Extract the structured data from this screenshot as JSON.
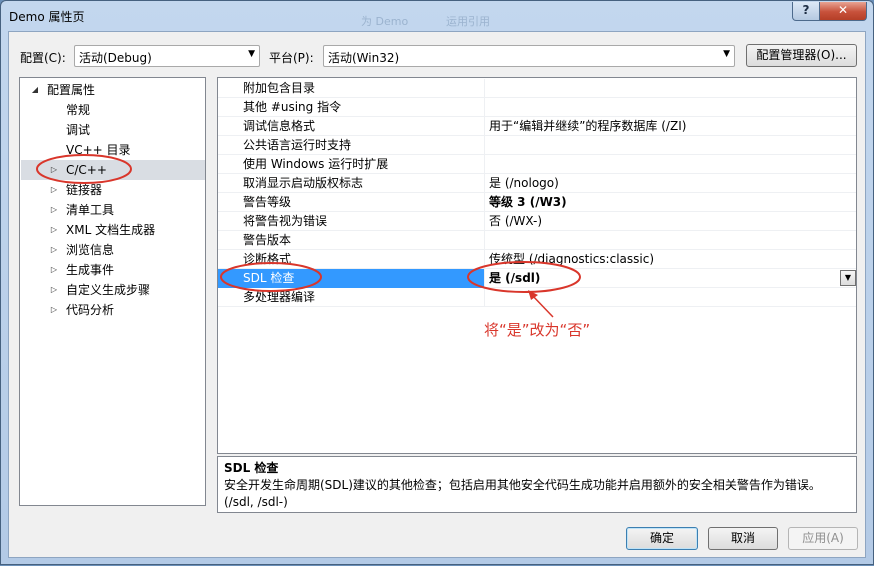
{
  "window": {
    "title": "Demo 属性页",
    "ghost_texts": [
      "为 Demo",
      "运用引用"
    ],
    "help_button": "?",
    "close_button": "✕"
  },
  "toolbar": {
    "config_label": "配置(C):",
    "config_value": "活动(Debug)",
    "platform_label": "平台(P):",
    "platform_value": "活动(Win32)",
    "config_manager_button": "配置管理器(O)..."
  },
  "tree": {
    "root": "配置属性",
    "items": [
      {
        "label": "常规",
        "expandable": false
      },
      {
        "label": "调试",
        "expandable": false
      },
      {
        "label": "VC++ 目录",
        "expandable": false
      },
      {
        "label": "C/C++",
        "expandable": true,
        "selected": true
      },
      {
        "label": "链接器",
        "expandable": true
      },
      {
        "label": "清单工具",
        "expandable": true
      },
      {
        "label": "XML 文档生成器",
        "expandable": true
      },
      {
        "label": "浏览信息",
        "expandable": true
      },
      {
        "label": "生成事件",
        "expandable": true
      },
      {
        "label": "自定义生成步骤",
        "expandable": true
      },
      {
        "label": "代码分析",
        "expandable": true
      }
    ]
  },
  "properties": [
    {
      "name": "附加包含目录",
      "value": ""
    },
    {
      "name": "其他 #using 指令",
      "value": ""
    },
    {
      "name": "调试信息格式",
      "value": "用于“编辑并继续”的程序数据库 (/ZI)"
    },
    {
      "name": "公共语言运行时支持",
      "value": ""
    },
    {
      "name": "使用 Windows 运行时扩展",
      "value": ""
    },
    {
      "name": "取消显示启动版权标志",
      "value": "是 (/nologo)"
    },
    {
      "name": "警告等级",
      "value": "等级 3 (/W3)",
      "bold": true
    },
    {
      "name": "将警告视为错误",
      "value": "否 (/WX-)"
    },
    {
      "name": "警告版本",
      "value": ""
    },
    {
      "name": "诊断格式",
      "value": "传统型 (/diagnostics:classic)"
    },
    {
      "name": "SDL 检查",
      "value": "是 (/sdl)",
      "selected": true
    },
    {
      "name": "多处理器编译",
      "value": ""
    }
  ],
  "description": {
    "title": "SDL 检查",
    "text": "安全开发生命周期(SDL)建议的其他检查；包括启用其他安全代码生成功能并启用额外的安全相关警告作为错误。",
    "switches": "(/sdl, /sdl-)"
  },
  "annotation": {
    "text": "将“是”改为“否”",
    "color": "#d9362b"
  },
  "buttons": {
    "ok": "确定",
    "cancel": "取消",
    "apply": "应用(A)"
  }
}
